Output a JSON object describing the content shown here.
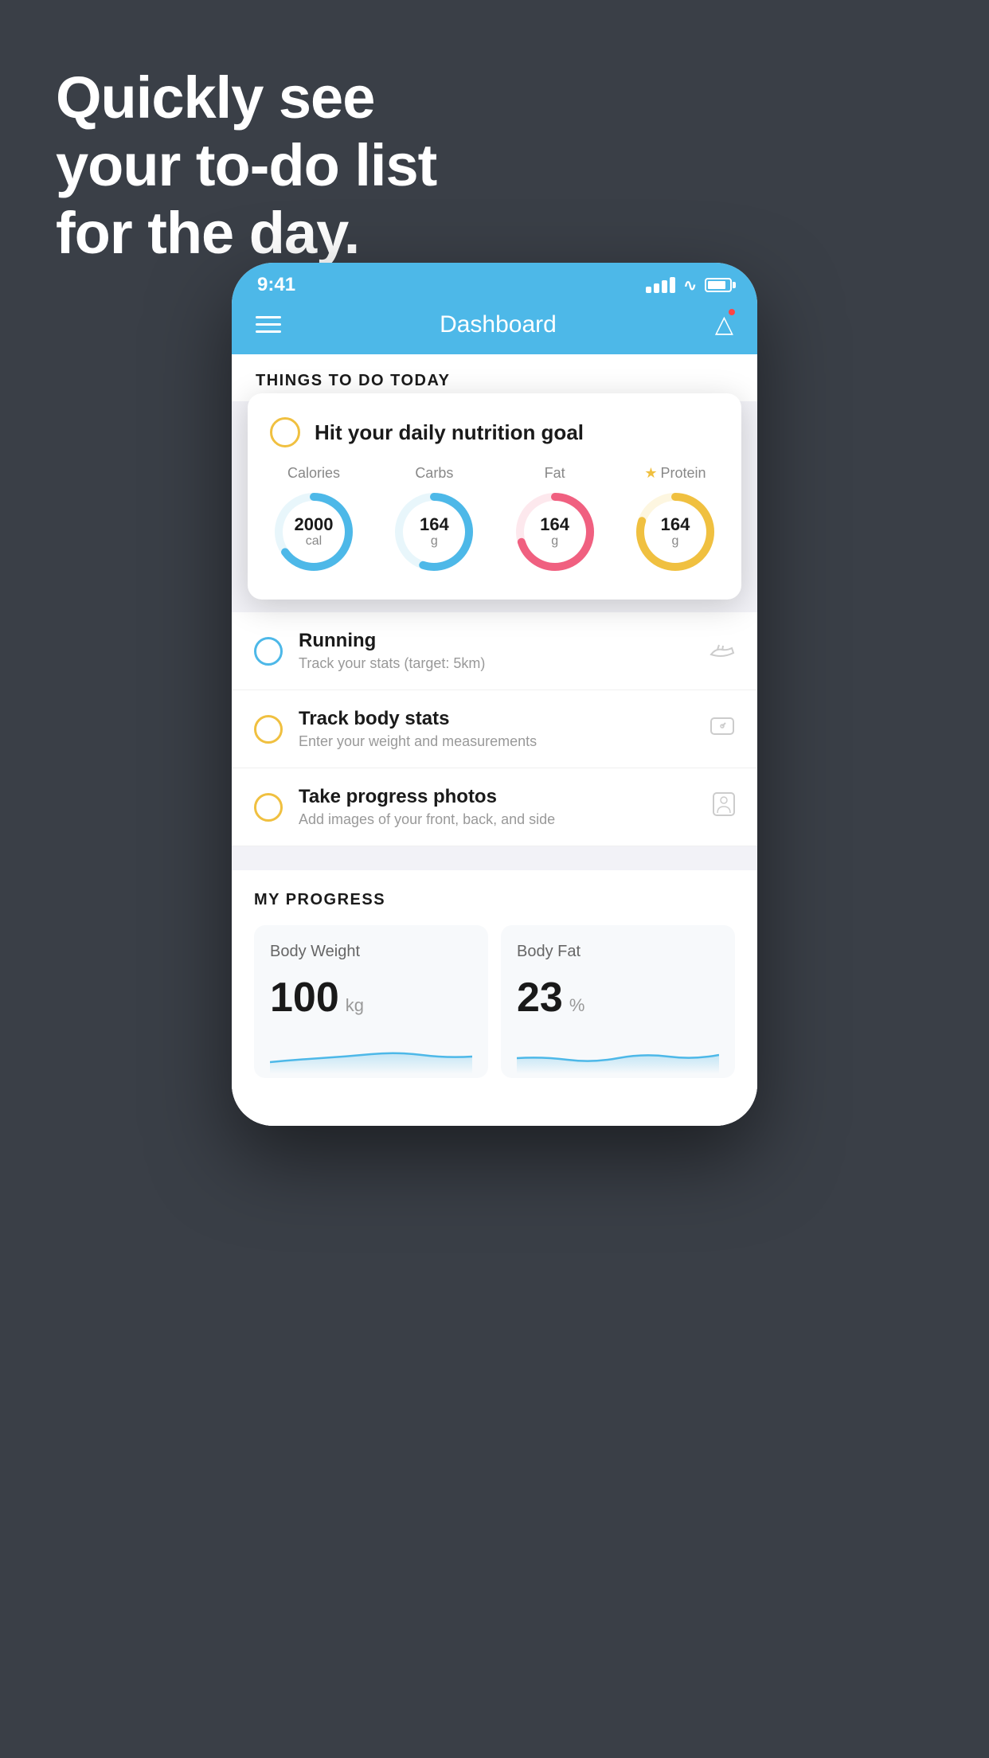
{
  "hero": {
    "line1": "Quickly see",
    "line2": "your to-do list",
    "line3": "for the day."
  },
  "statusBar": {
    "time": "9:41"
  },
  "navbar": {
    "title": "Dashboard"
  },
  "thingsToDo": {
    "header": "THINGS TO DO TODAY",
    "expandedCard": {
      "circleColor": "#f0c040",
      "title": "Hit your daily nutrition goal",
      "nutrients": [
        {
          "label": "Calories",
          "value": "2000",
          "unit": "cal",
          "color": "#4db8e8",
          "bgColor": "#e8f6fb",
          "percent": 65,
          "star": false
        },
        {
          "label": "Carbs",
          "value": "164",
          "unit": "g",
          "color": "#4db8e8",
          "bgColor": "#e8f6fb",
          "percent": 55,
          "star": false
        },
        {
          "label": "Fat",
          "value": "164",
          "unit": "g",
          "color": "#f06080",
          "bgColor": "#fde8ed",
          "percent": 70,
          "star": false
        },
        {
          "label": "Protein",
          "value": "164",
          "unit": "g",
          "color": "#f0c040",
          "bgColor": "#fdf6e0",
          "percent": 80,
          "star": true
        }
      ]
    },
    "items": [
      {
        "title": "Running",
        "subtitle": "Track your stats (target: 5km)",
        "circleColor": "#4db8e8",
        "iconType": "shoe"
      },
      {
        "title": "Track body stats",
        "subtitle": "Enter your weight and measurements",
        "circleColor": "#f0c040",
        "iconType": "scale"
      },
      {
        "title": "Take progress photos",
        "subtitle": "Add images of your front, back, and side",
        "circleColor": "#f0c040",
        "iconType": "person"
      }
    ]
  },
  "myProgress": {
    "header": "MY PROGRESS",
    "cards": [
      {
        "title": "Body Weight",
        "value": "100",
        "unit": "kg"
      },
      {
        "title": "Body Fat",
        "value": "23",
        "unit": "%"
      }
    ]
  }
}
